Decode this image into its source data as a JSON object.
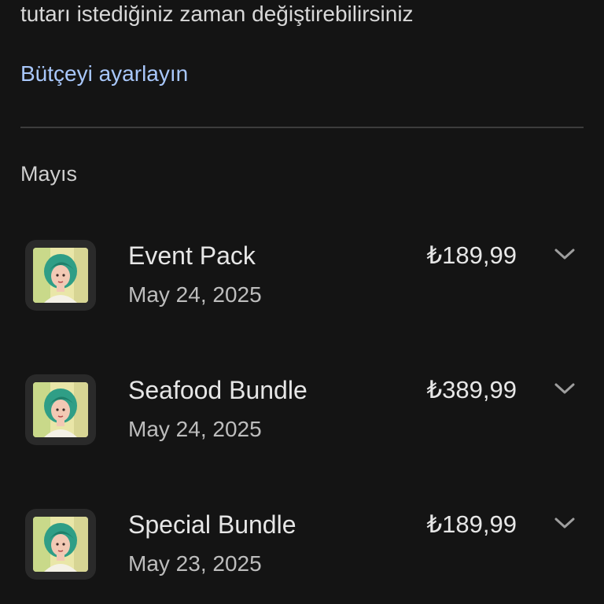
{
  "budget": {
    "description": "tutarı istediğiniz zaman değiştirebilirsiniz",
    "link_label": "Bütçeyi ayarlayın"
  },
  "month_label": "Mayıs",
  "purchases": [
    {
      "title": "Event Pack",
      "date": "May 24, 2025",
      "price": "₺189,99",
      "icon": "game-character-icon"
    },
    {
      "title": "Seafood Bundle",
      "date": "May 24, 2025",
      "price": "₺389,99",
      "icon": "game-character-icon"
    },
    {
      "title": "Special Bundle",
      "date": "May 23, 2025",
      "price": "₺189,99",
      "icon": "game-character-icon"
    }
  ],
  "colors": {
    "background": "#141414",
    "link": "#a8c7fa",
    "divider": "#3c3c3c"
  }
}
